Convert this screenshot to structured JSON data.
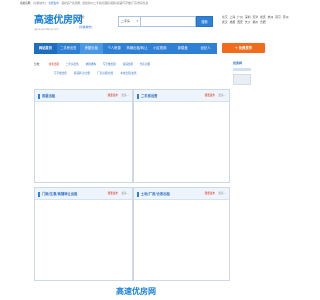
{
  "topbar": {
    "city": "宿松房网",
    "switch": "[切换城市]",
    "link": "免费发布",
    "hint": "宿松房产信息网：宿松房价/二手房/出租房/租房/商铺/写字楼/厂房/仓库信息"
  },
  "logo": {
    "main": "高速优房网",
    "sub": "gaosuyoufang.com"
  },
  "city": {
    "pin": "宿松",
    "switch": "[切换城市]"
  },
  "search": {
    "select": "二手房",
    "placeholder": "",
    "button": "搜索"
  },
  "hot_cities": [
    "北京",
    "上海",
    "广州",
    "深圳",
    "天津",
    "重庆",
    "杭州",
    "南京",
    "苏州",
    "武汉",
    "成都",
    "西安",
    "长沙",
    "郑州",
    "合肥"
  ],
  "post_button": {
    "label": "免费发布"
  },
  "nav": [
    {
      "label": "网站首页",
      "key": "home"
    },
    {
      "label": "二手房出售",
      "key": "sale"
    },
    {
      "label": "房屋出租",
      "key": "rent"
    },
    {
      "label": "个人房源",
      "key": "personal"
    },
    {
      "label": "商铺出租/转让",
      "key": "shop"
    },
    {
      "label": "小区视频",
      "key": "video"
    },
    {
      "label": "新楼盘",
      "key": "newhouse"
    },
    {
      "label": "经纪人",
      "key": "agent"
    }
  ],
  "filter": {
    "row1": {
      "label": "分类：",
      "items": [
        "住宅出租",
        "二手房出售",
        "求租求购",
        "写字楼出租",
        "商铺出租",
        "仓库出租"
      ]
    },
    "row2": {
      "items": [
        "写字楼出售",
        "商铺转让/出售",
        "厂房出租/出售",
        "车位出租/出售"
      ]
    }
  },
  "right_box": {
    "logo": "优房网"
  },
  "panels": [
    {
      "title": "房屋出租",
      "post": "我要发布",
      "more": "更多..."
    },
    {
      "title": "二手房出售",
      "post": "我要发布",
      "more": "更多..."
    },
    {
      "title": "门面/生意/商铺转让出租",
      "post": "我要发布",
      "more": "更多..."
    },
    {
      "title": "土地/厂房/仓库出租",
      "post": "我要发布",
      "more": "更多..."
    }
  ],
  "footer": {
    "logo": "高速优房网"
  },
  "colors": {
    "brand": "#2f7fd4",
    "accent": "#f26a1b",
    "link": "#2a6ec2"
  }
}
